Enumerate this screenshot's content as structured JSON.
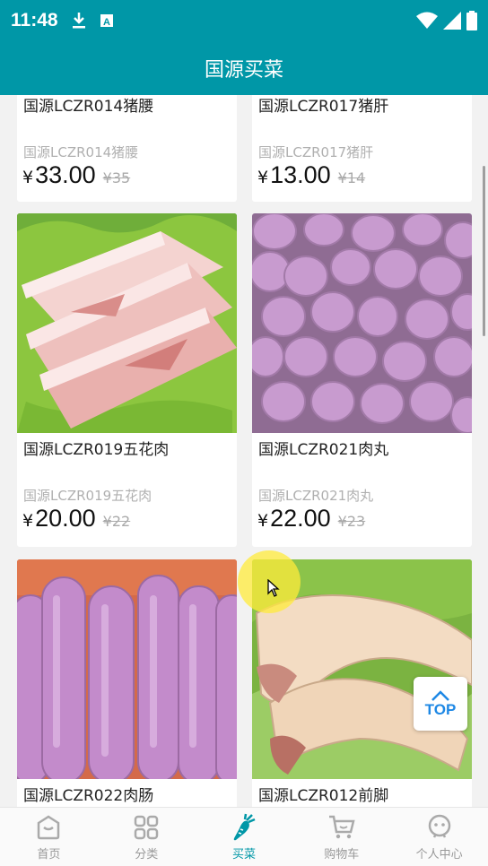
{
  "status_bar": {
    "time": "11:48",
    "download_icon": "download-icon",
    "app_icon": "a-app-icon",
    "wifi_icon": "wifi-icon",
    "signal_icon": "signal-icon",
    "battery_icon": "battery-icon"
  },
  "app_bar": {
    "title": "国源买菜"
  },
  "products": [
    {
      "name": "国源LCZR014猪腰",
      "subtitle": "国源LCZR014猪腰",
      "currency": "¥",
      "price": "33.00",
      "old_price": "¥35"
    },
    {
      "name": "国源LCZR017猪肝",
      "subtitle": "国源LCZR017猪肝",
      "currency": "¥",
      "price": "13.00",
      "old_price": "¥14"
    },
    {
      "name": "国源LCZR019五花肉",
      "subtitle": "国源LCZR019五花肉",
      "currency": "¥",
      "price": "20.00",
      "old_price": "¥22"
    },
    {
      "name": "国源LCZR021肉丸",
      "subtitle": "国源LCZR021肉丸",
      "currency": "¥",
      "price": "22.00",
      "old_price": "¥23"
    },
    {
      "name": "国源LCZR022肉肠"
    },
    {
      "name": "国源LCZR012前脚"
    }
  ],
  "top_button": {
    "label": "TOP"
  },
  "tabs": [
    {
      "label": "首页",
      "icon": "home-icon"
    },
    {
      "label": "分类",
      "icon": "grid-icon"
    },
    {
      "label": "买菜",
      "icon": "carrot-icon",
      "active": true
    },
    {
      "label": "购物车",
      "icon": "cart-icon"
    },
    {
      "label": "个人中心",
      "icon": "person-icon"
    }
  ],
  "colors": {
    "primary": "#0097a7",
    "top_button": "#1e88e5"
  }
}
